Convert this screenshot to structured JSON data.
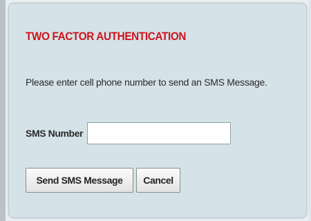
{
  "dialog": {
    "title": "TWO FACTOR AUTHENTICATION",
    "description": "Please enter cell phone number to send an SMS Message.",
    "sms_number_label": "SMS Number",
    "sms_number_value": "",
    "send_button_label": "Send SMS Message",
    "cancel_button_label": "Cancel"
  },
  "colors": {
    "title": "#d0121b",
    "panel_background": "#d5e3e8",
    "outer_background": "#e9eef0"
  }
}
